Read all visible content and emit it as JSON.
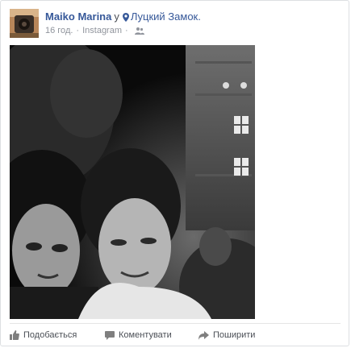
{
  "post": {
    "author": "Maiko Marina",
    "in_word": "у",
    "location": "Луцкий Замок.",
    "timestamp": "16 год.",
    "separator": "·",
    "source": "Instagram",
    "icons": {
      "location": "location-pin-icon",
      "audience": "friends-audience-icon"
    }
  },
  "actions": {
    "like": "Подобається",
    "comment": "Коментувати",
    "share": "Поширити"
  },
  "colors": {
    "link": "#365899",
    "meta": "#90949c",
    "action_text": "#4b4f56"
  }
}
